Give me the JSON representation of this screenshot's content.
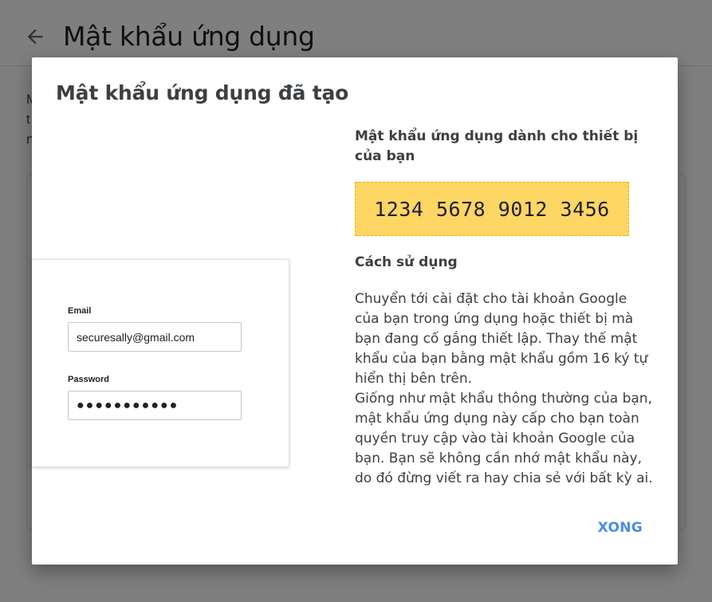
{
  "background": {
    "page_title": "Mật khẩu ứng dụng",
    "intro_text": "M\nt\nn"
  },
  "dialog": {
    "title": "Mật khẩu ứng dụng đã tạo",
    "illustration": {
      "email_label": "Email",
      "email_value": "securesally@gmail.com",
      "password_label": "Password",
      "password_value": "●●●●●●●●●●●"
    },
    "password_heading": "Mật khẩu ứng dụng dành cho thiết bị của bạn",
    "app_password": "1234 5678 9012 3456",
    "howto_heading": "Cách sử dụng",
    "instructions": [
      "Chuyển tới cài đặt cho tài khoản Google của bạn trong ứng dụng hoặc thiết bị mà bạn đang cố gắng thiết lập. Thay thế mật khẩu của bạn bằng mật khẩu gồm 16 ký tự hiển thị bên trên.",
      "Giống như mật khẩu thông thường của bạn, mật khẩu ứng dụng này cấp cho bạn toàn quyền truy cập vào tài khoản Google của bạn. Bạn sẽ không cần nhớ mật khẩu này, do đó đừng viết ra hay chia sẻ với bất kỳ ai."
    ],
    "done_label": "XONG"
  },
  "colors": {
    "code_highlight": "#fdd663",
    "accent": "#4a8ee6",
    "scrim": "rgba(0,0,0,0.5)"
  }
}
